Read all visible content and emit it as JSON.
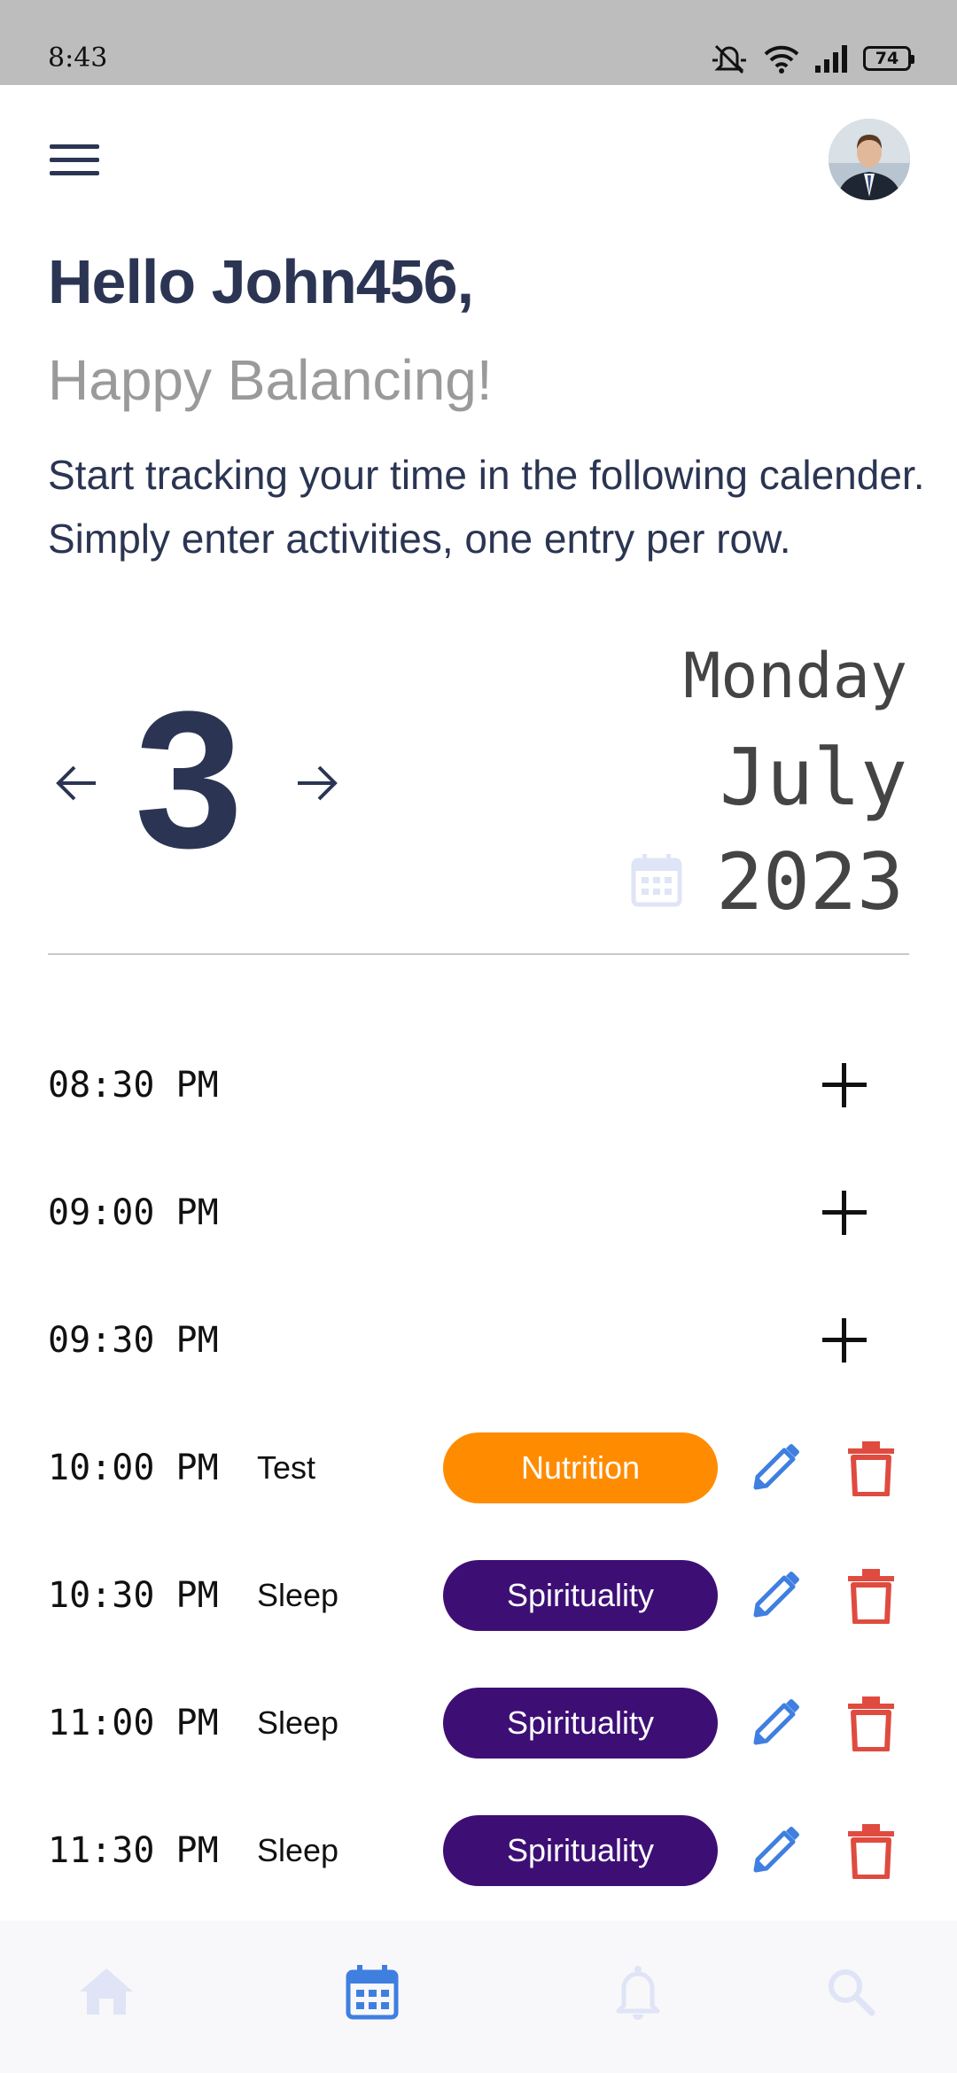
{
  "status_bar": {
    "time": "8:43",
    "battery": "74"
  },
  "header": {
    "greeting": "Hello John456,",
    "subtitle": "Happy Balancing!",
    "intro": "Start tracking your time in the following calender. Simply enter activities, one entry per row."
  },
  "date": {
    "day": "3",
    "weekday": "Monday",
    "month": "July",
    "year": "2023"
  },
  "slots": [
    {
      "time": "08:30 PM",
      "activity": "",
      "category": ""
    },
    {
      "time": "09:00 PM",
      "activity": "",
      "category": ""
    },
    {
      "time": "09:30 PM",
      "activity": "",
      "category": ""
    },
    {
      "time": "10:00 PM",
      "activity": "Test",
      "category": "Nutrition"
    },
    {
      "time": "10:30 PM",
      "activity": "Sleep",
      "category": "Spirituality"
    },
    {
      "time": "11:00 PM",
      "activity": "Sleep",
      "category": "Spirituality"
    },
    {
      "time": "11:30 PM",
      "activity": "Sleep",
      "category": "Spirituality"
    }
  ],
  "colors": {
    "primary_text": "#2b3553",
    "nutrition": "#ff8c00",
    "spirituality": "#3d0f75",
    "edit_icon": "#3f7fe0",
    "delete_icon": "#e04b3f",
    "nav_active": "#3f7fe0",
    "nav_inactive": "#dfe4f6"
  },
  "bottom_nav": {
    "items": [
      "home-icon",
      "calendar-icon",
      "bell-icon",
      "search-icon"
    ],
    "active": "calendar-icon"
  }
}
